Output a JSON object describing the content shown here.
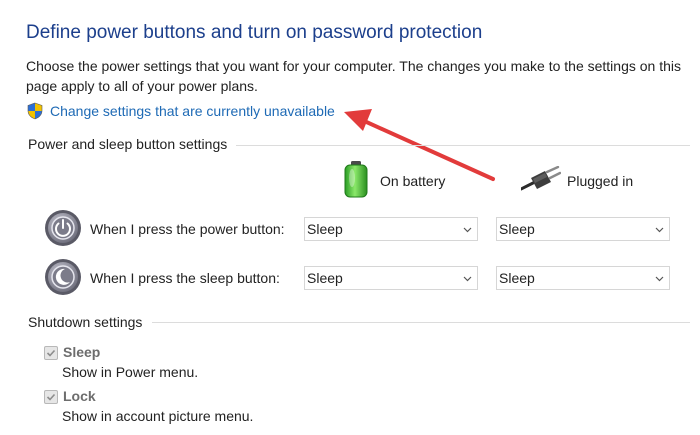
{
  "page": {
    "title": "Define power buttons and turn on password protection",
    "intro": "Choose the power settings that you want for your computer. The changes you make to the settings on this page apply to all of your power plans.",
    "change_link": "Change settings that are currently unavailable",
    "change_link_icon": "uac-shield-icon"
  },
  "power_sleep": {
    "header": "Power and sleep button settings",
    "columns": [
      {
        "label": "On battery",
        "icon": "battery-icon"
      },
      {
        "label": "Plugged in",
        "icon": "power-plug-icon"
      }
    ],
    "rows": [
      {
        "label": "When I press the power button:",
        "icon": "power-button-icon",
        "on_battery": "Sleep",
        "plugged_in": "Sleep"
      },
      {
        "label": "When I press the sleep button:",
        "icon": "sleep-button-icon",
        "on_battery": "Sleep",
        "plugged_in": "Sleep"
      }
    ]
  },
  "shutdown": {
    "header": "Shutdown settings",
    "items": [
      {
        "title": "Sleep",
        "description": "Show in Power menu.",
        "checked": true,
        "enabled": false
      },
      {
        "title": "Lock",
        "description": "Show in account picture menu.",
        "checked": true,
        "enabled": false
      }
    ]
  },
  "annotation": {
    "arrow_color": "#e23b3b"
  },
  "colors": {
    "title": "#1c3f8c",
    "link": "#1e6ab5",
    "arrow": "#e23b3b"
  }
}
